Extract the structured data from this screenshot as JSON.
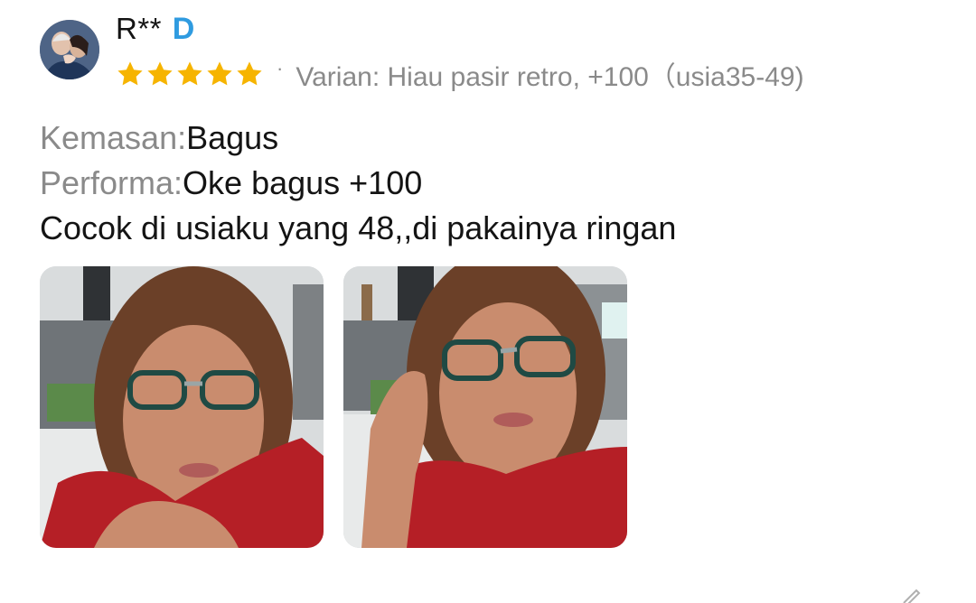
{
  "review": {
    "username": "R**",
    "badge_letter": "D",
    "rating": 5,
    "variant_text": "Varian: Hiau pasir retro, +100（usia35-49)",
    "lines": [
      {
        "label": "Kemasan:",
        "value": "Bagus"
      },
      {
        "label": "Performa:",
        "value": "Oke bagus +100"
      },
      {
        "label": "",
        "value": "Cocok di usiaku yang 48,,di pakainya ringan"
      }
    ],
    "photos": [
      {
        "icon": "review-photo-1"
      },
      {
        "icon": "review-photo-2"
      }
    ]
  },
  "colors": {
    "star": "#f6b400",
    "badge": "#2f9be0",
    "muted_text": "#8a8a8a",
    "text": "#141414",
    "shirt": "#b51f26"
  }
}
